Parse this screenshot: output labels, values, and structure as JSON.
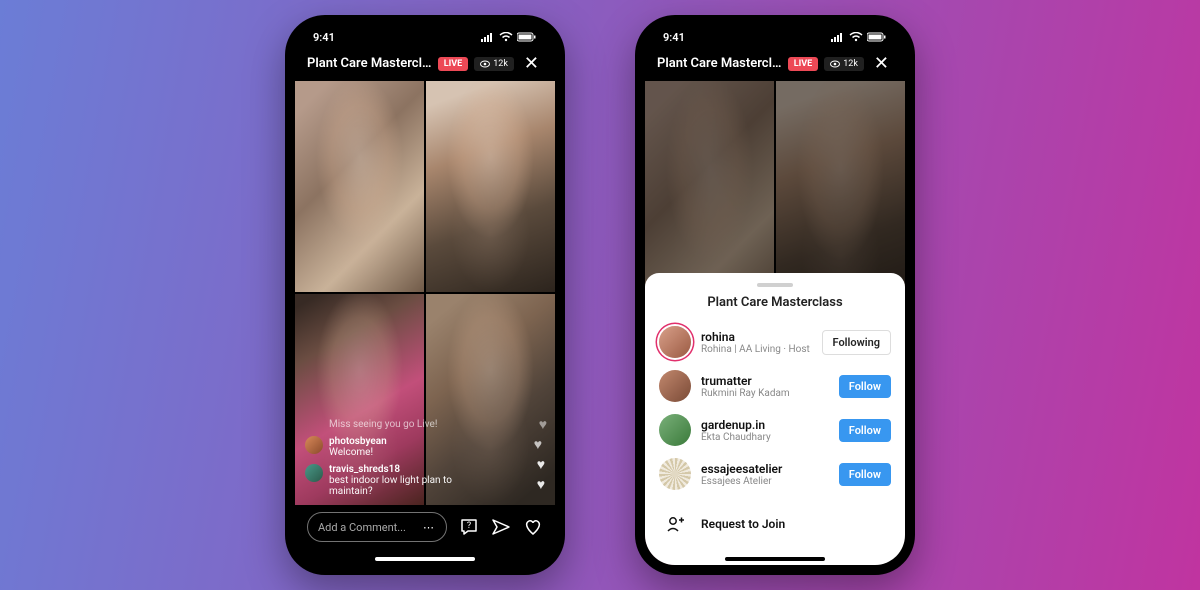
{
  "status": {
    "time": "9:41"
  },
  "live": {
    "title": "Plant Care Masterclas...",
    "live_label": "LIVE",
    "viewers": "12k"
  },
  "comments": [
    {
      "text": "Miss seeing you go Live!"
    },
    {
      "user": "photosbyean",
      "text": "Welcome!"
    },
    {
      "user": "travis_shreds18",
      "text": "best indoor low light plan to maintain?"
    }
  ],
  "compose": {
    "placeholder": "Add a Comment..."
  },
  "sheet": {
    "title": "Plant Care Masterclass",
    "participants": [
      {
        "username": "rohina",
        "subtitle": "Rohina | AA Living · Host",
        "action": "Following"
      },
      {
        "username": "trumatter",
        "subtitle": "Rukmini Ray Kadam",
        "action": "Follow"
      },
      {
        "username": "gardenup.in",
        "subtitle": "Ekta Chaudhary",
        "action": "Follow"
      },
      {
        "username": "essajeesatelier",
        "subtitle": "Essajees Atelier",
        "action": "Follow"
      }
    ],
    "request": "Request to Join"
  }
}
